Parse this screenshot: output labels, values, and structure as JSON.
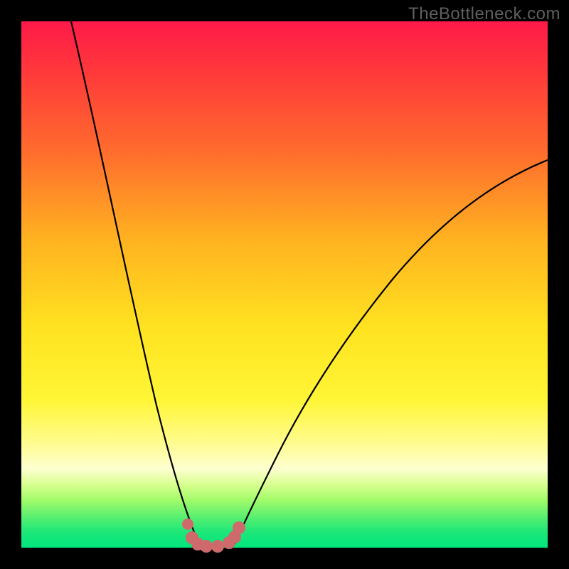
{
  "watermark": "TheBottleneck.com",
  "chart_data": {
    "type": "line",
    "title": "",
    "xlabel": "",
    "ylabel": "",
    "xlim": [
      0,
      1
    ],
    "ylim": [
      0,
      100
    ],
    "series": [
      {
        "name": "left-branch",
        "x": [
          0.095,
          0.12,
          0.15,
          0.18,
          0.21,
          0.24,
          0.26,
          0.28,
          0.3,
          0.315,
          0.33
        ],
        "bottleneck_pct": [
          100,
          87,
          74,
          60,
          47,
          34,
          23,
          15,
          8,
          3,
          0
        ]
      },
      {
        "name": "right-branch",
        "x": [
          0.41,
          0.44,
          0.48,
          0.53,
          0.59,
          0.66,
          0.74,
          0.82,
          0.9,
          1.0
        ],
        "bottleneck_pct": [
          0,
          6,
          13,
          22,
          31,
          40,
          49,
          57,
          63,
          70
        ]
      }
    ],
    "highlight_points": {
      "name": "optimal-zone",
      "color": "#d46a6a",
      "points": [
        {
          "x": 0.315,
          "bottleneck_pct": 4
        },
        {
          "x": 0.323,
          "bottleneck_pct": 1.5
        },
        {
          "x": 0.333,
          "bottleneck_pct": 0.5
        },
        {
          "x": 0.35,
          "bottleneck_pct": 0
        },
        {
          "x": 0.372,
          "bottleneck_pct": 0
        },
        {
          "x": 0.395,
          "bottleneck_pct": 0.8
        },
        {
          "x": 0.405,
          "bottleneck_pct": 2
        },
        {
          "x": 0.413,
          "bottleneck_pct": 3.8
        }
      ]
    },
    "gradient_stops": [
      {
        "pct": 0,
        "color": "#ff1a49"
      },
      {
        "pct": 25,
        "color": "#ff6d2d"
      },
      {
        "pct": 58,
        "color": "#ffe220"
      },
      {
        "pct": 85,
        "color": "#fdffd0"
      },
      {
        "pct": 100,
        "color": "#00e67e"
      }
    ]
  }
}
